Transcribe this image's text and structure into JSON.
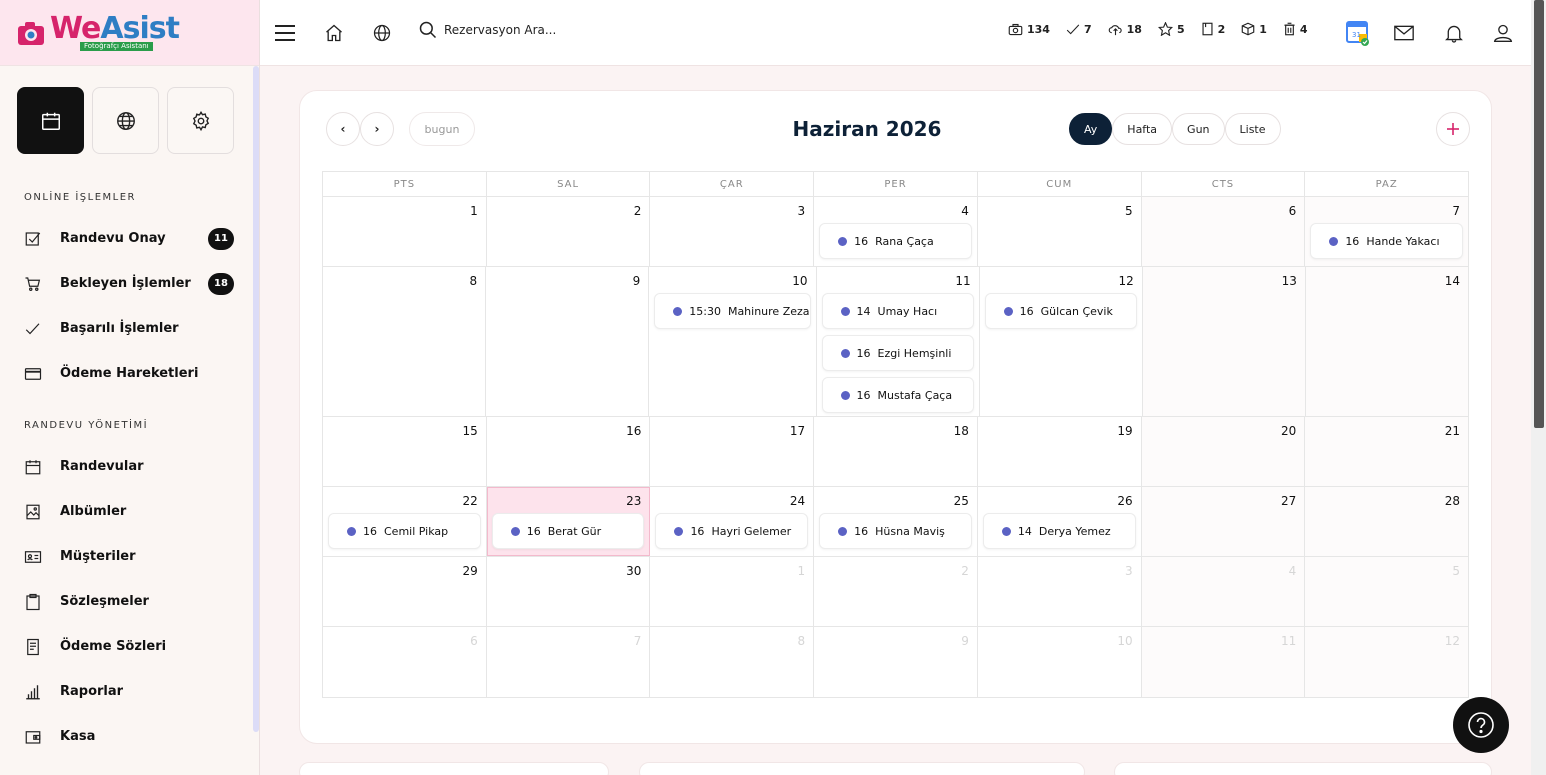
{
  "brand": {
    "name_we": "We",
    "name_rest": "Asist",
    "tagline": "Fotoğrafçı Asistanı"
  },
  "sections": {
    "online": "ONLİNE İŞLEMLER",
    "appointment": "RANDEVU YÖNETİMİ"
  },
  "online_menu": [
    {
      "label": "Randevu Onay",
      "badge": "11",
      "icon": "check-square-icon"
    },
    {
      "label": "Bekleyen İşlemler",
      "badge": "18",
      "icon": "cart-icon"
    },
    {
      "label": "Başarılı İşlemler",
      "badge": "",
      "icon": "check-icon"
    },
    {
      "label": "Ödeme Hareketleri",
      "badge": "",
      "icon": "credit-card-icon"
    }
  ],
  "appointment_menu": [
    {
      "label": "Randevular",
      "icon": "calendar-icon"
    },
    {
      "label": "Albümler",
      "icon": "album-icon"
    },
    {
      "label": "Müşteriler",
      "icon": "id-card-icon"
    },
    {
      "label": "Sözleşmeler",
      "icon": "clipboard-icon"
    },
    {
      "label": "Ödeme Sözleri",
      "icon": "receipt-icon"
    },
    {
      "label": "Raporlar",
      "icon": "bar-chart-icon"
    },
    {
      "label": "Kasa",
      "icon": "wallet-icon"
    }
  ],
  "header": {
    "search_placeholder": "Rezervasyon Ara...",
    "stats": [
      {
        "icon": "camera-icon",
        "value": "134"
      },
      {
        "icon": "check-icon",
        "value": "7"
      },
      {
        "icon": "cloud-upload-icon",
        "value": "18"
      },
      {
        "icon": "star-icon",
        "value": "5"
      },
      {
        "icon": "bookmark-icon",
        "value": "2"
      },
      {
        "icon": "box-icon",
        "value": "1"
      },
      {
        "icon": "trash-icon",
        "value": "4"
      }
    ]
  },
  "calendar": {
    "title": "Haziran 2026",
    "today_label": "bugun",
    "prev_label": "‹",
    "next_label": "›",
    "views": [
      "Ay",
      "Hafta",
      "Gun",
      "Liste"
    ],
    "active_view": "Ay",
    "weekdays": [
      "PTS",
      "SAL",
      "ÇAR",
      "PER",
      "CUM",
      "CTS",
      "PAZ"
    ],
    "weeks": [
      {
        "h": 70,
        "days": [
          {
            "n": "1"
          },
          {
            "n": "2"
          },
          {
            "n": "3"
          },
          {
            "n": "4",
            "events": [
              {
                "time": "16",
                "name": "Rana Çaça"
              }
            ]
          },
          {
            "n": "5"
          },
          {
            "n": "6"
          },
          {
            "n": "7",
            "events": [
              {
                "time": "16",
                "name": "Hande Yakacı"
              }
            ]
          }
        ]
      },
      {
        "h": 150,
        "days": [
          {
            "n": "8"
          },
          {
            "n": "9"
          },
          {
            "n": "10",
            "events": [
              {
                "time": "15:30",
                "name": "Mahinure Zeza"
              }
            ]
          },
          {
            "n": "11",
            "events": [
              {
                "time": "14",
                "name": "Umay Hacı"
              },
              {
                "time": "16",
                "name": "Ezgi Hemşinli"
              },
              {
                "time": "16",
                "name": "Mustafa Çaça"
              }
            ]
          },
          {
            "n": "12",
            "events": [
              {
                "time": "16",
                "name": "Gülcan Çevik"
              }
            ]
          },
          {
            "n": "13"
          },
          {
            "n": "14"
          }
        ]
      },
      {
        "h": 70,
        "days": [
          {
            "n": "15"
          },
          {
            "n": "16"
          },
          {
            "n": "17"
          },
          {
            "n": "18"
          },
          {
            "n": "19"
          },
          {
            "n": "20"
          },
          {
            "n": "21"
          }
        ]
      },
      {
        "h": 70,
        "days": [
          {
            "n": "22",
            "events": [
              {
                "time": "16",
                "name": "Cemil Pikap"
              }
            ]
          },
          {
            "n": "23",
            "today": true,
            "events": [
              {
                "time": "16",
                "name": "Berat Gür"
              }
            ]
          },
          {
            "n": "24",
            "events": [
              {
                "time": "16",
                "name": "Hayri Gelemer"
              }
            ]
          },
          {
            "n": "25",
            "events": [
              {
                "time": "16",
                "name": "Hüsna Maviş"
              }
            ]
          },
          {
            "n": "26",
            "events": [
              {
                "time": "14",
                "name": "Derya Yemez"
              }
            ]
          },
          {
            "n": "27"
          },
          {
            "n": "28"
          }
        ]
      },
      {
        "h": 70,
        "days": [
          {
            "n": "29"
          },
          {
            "n": "30"
          },
          {
            "n": "1",
            "other": true
          },
          {
            "n": "2",
            "other": true
          },
          {
            "n": "3",
            "other": true
          },
          {
            "n": "4",
            "other": true
          },
          {
            "n": "5",
            "other": true
          }
        ]
      },
      {
        "h": 70,
        "days": [
          {
            "n": "6",
            "other": true
          },
          {
            "n": "7",
            "other": true
          },
          {
            "n": "8",
            "other": true
          },
          {
            "n": "9",
            "other": true
          },
          {
            "n": "10",
            "other": true
          },
          {
            "n": "11",
            "other": true
          },
          {
            "n": "12",
            "other": true
          }
        ]
      }
    ]
  },
  "colors": {
    "dark": "#0d2137",
    "event_dot": "#5b62c4",
    "today_bg": "#fde3ec"
  }
}
